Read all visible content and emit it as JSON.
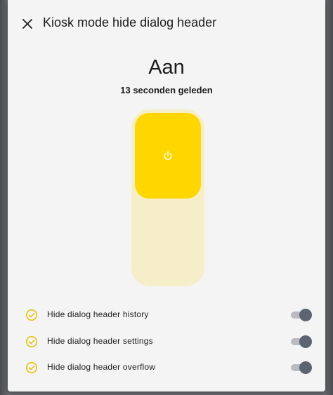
{
  "dialog": {
    "title": "Kiosk mode hide dialog header",
    "close_icon": "close-icon"
  },
  "entity": {
    "state": "Aan",
    "last_changed": "13 seconden geleden",
    "slider_level_percent": 50,
    "power_icon": "power-icon",
    "accent_color": "#ffd700",
    "track_color": "#f6eec8"
  },
  "rows": [
    {
      "label": "Hide dialog header history",
      "icon": "check-circle-icon",
      "toggle_on": true
    },
    {
      "label": "Hide dialog header settings",
      "icon": "check-circle-icon",
      "toggle_on": true
    },
    {
      "label": "Hide dialog header overflow",
      "icon": "check-circle-icon",
      "toggle_on": true
    }
  ],
  "colors": {
    "check_icon": "#e8c20a",
    "toggle_knob": "#5b6470",
    "toggle_track": "#b9bbc0"
  }
}
